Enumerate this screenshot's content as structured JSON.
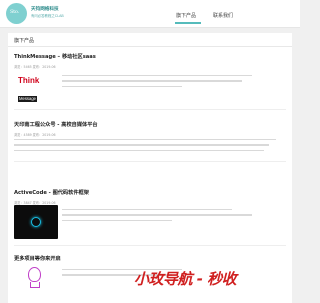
{
  "header": {
    "logo_text": "Sto.",
    "brand": "天钧网络科技",
    "tagline": "有问必答教程之CLAB",
    "nav": [
      "旗下产品",
      "联系我们"
    ]
  },
  "section": {
    "title": "旗下产品"
  },
  "articles": [
    {
      "title": "ThinkMessage – 移动社区saas",
      "meta": "浏览：5465    发布：2019-06",
      "thumb_top": "Think",
      "thumb_bottom": "Message"
    },
    {
      "title": "天印南工程公众号 - 高校自媒体平台",
      "meta": "浏览：4589    发布：2019-06"
    },
    {
      "title": "ActiveCode - 图代码软件框架",
      "meta": "浏览：3847    发布：2019-06"
    },
    {
      "title": "更多项目等你来开启",
      "meta": ""
    }
  ],
  "watermark": "小玫导航 - 秒收",
  "colors": {
    "accent": "#5bbbbb",
    "brand_red": "#d0021b",
    "power_glow": "#19c1e6",
    "bulb": "#c040c8"
  }
}
